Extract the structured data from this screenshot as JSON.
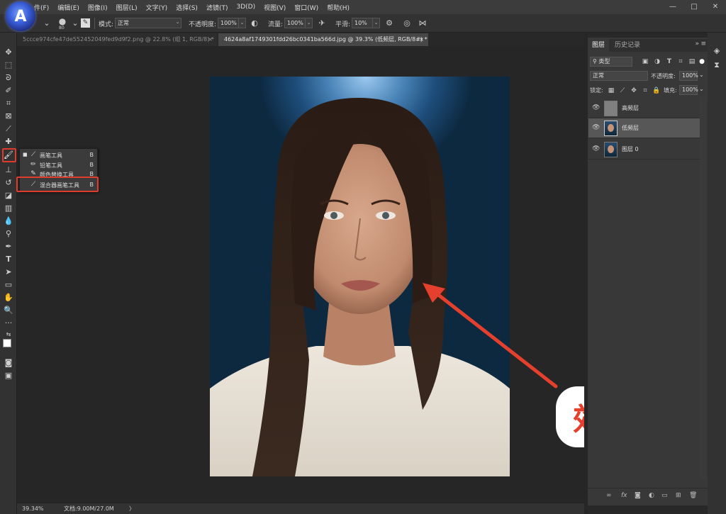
{
  "menubar": {
    "items": [
      "件(F)",
      "编辑(E)",
      "图像(I)",
      "图层(L)",
      "文字(Y)",
      "选择(S)",
      "滤镜(T)",
      "3D(D)",
      "视图(V)",
      "窗口(W)",
      "帮助(H)"
    ],
    "logo_letter": "A"
  },
  "options": {
    "brush_size": "80",
    "mode_label": "模式:",
    "mode_value": "正常",
    "opacity_label": "不透明度:",
    "opacity_value": "100%",
    "flow_label": "流量:",
    "flow_value": "100%",
    "smooth_label": "平滑:",
    "smooth_value": "10%"
  },
  "tabs": [
    {
      "title": "5ccce974cfe47de552452049fed9d9f2.png @ 22.8% (组 1, RGB/8) *",
      "close": "×"
    },
    {
      "title": "4624a8af1749301fdd26bc0341ba566d.jpg @ 39.3% (低频层, RGB/8#) *",
      "close": "×"
    }
  ],
  "flyout": {
    "items": [
      {
        "label": "画笔工具",
        "key": "B",
        "active": true
      },
      {
        "label": "铅笔工具",
        "key": "B"
      },
      {
        "label": "颜色替换工具",
        "key": "B"
      },
      {
        "label": "混合器画笔工具",
        "key": "B"
      }
    ]
  },
  "annotation": {
    "text": "效果图"
  },
  "status": {
    "zoom": "39.34%",
    "doc": "文档:9.00M/27.0M",
    "arrow": "〉"
  },
  "panel": {
    "tabs": [
      "图层",
      "历史记录"
    ],
    "filter_kind": "类型",
    "blend_mode": "正常",
    "opacity_label": "不透明度:",
    "opacity_value": "100%",
    "lock_label": "锁定:",
    "fill_label": "填充:",
    "fill_value": "100%",
    "layers": [
      {
        "name": "高频层",
        "selected": false
      },
      {
        "name": "低频层",
        "selected": true
      },
      {
        "name": "图层 0",
        "selected": false
      }
    ],
    "bottom_icons": [
      "link-icon",
      "fx-icon",
      "mask-icon",
      "adjustment-icon",
      "folder-icon",
      "new-layer-icon",
      "trash-icon"
    ]
  },
  "colors": {
    "highlight_red": "#e03c2c",
    "annotation_red": "#e5402e",
    "background_top": "#9cc9ef",
    "background_bottom": "#0d2940"
  }
}
